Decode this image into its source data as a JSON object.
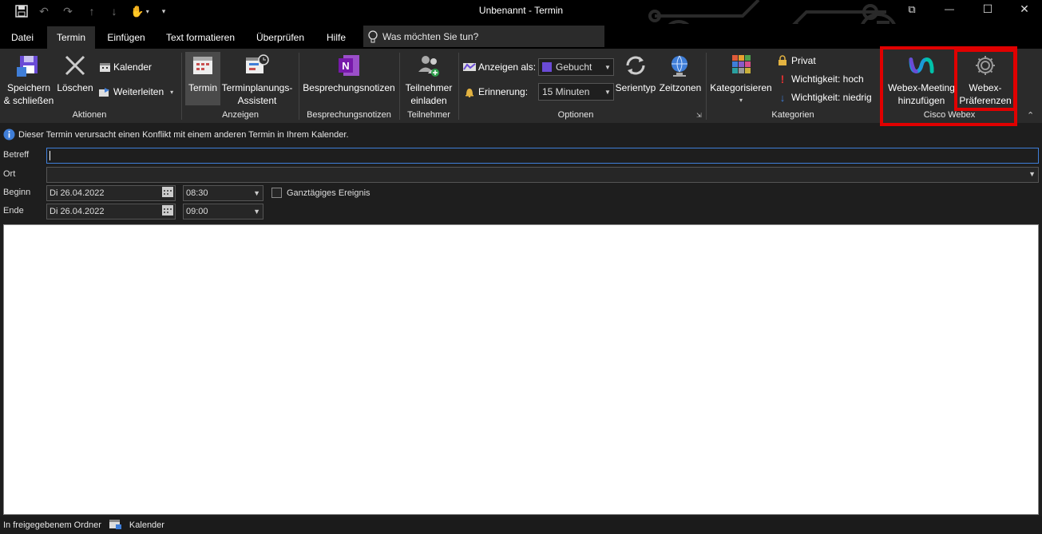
{
  "window": {
    "title": "Unbenannt  -  Termin",
    "controls": {
      "restore": "⧉",
      "minimize": "—",
      "maximize": "☐",
      "close": "✕"
    }
  },
  "tabs": [
    "Datei",
    "Termin",
    "Einfügen",
    "Text formatieren",
    "Überprüfen",
    "Hilfe"
  ],
  "active_tab": "Termin",
  "search_placeholder": "Was möchten Sie tun?",
  "ribbon": {
    "aktionen": {
      "save_label_1": "Speichern",
      "save_label_2": "& schließen",
      "delete_label": "Löschen",
      "calendar_label": "Kalender",
      "forward_label": "Weiterleiten",
      "group_label": "Aktionen"
    },
    "anzeigen": {
      "termin_label": "Termin",
      "assistant_label_1": "Terminplanungs-",
      "assistant_label_2": "Assistent",
      "group_label": "Anzeigen"
    },
    "notizen": {
      "notes_label": "Besprechungsnotizen",
      "group_label": "Besprechungsnotizen"
    },
    "teilnehmer": {
      "invite_label_1": "Teilnehmer",
      "invite_label_2": "einladen",
      "group_label": "Teilnehmer"
    },
    "optionen": {
      "show_as_label": "Anzeigen als:",
      "show_as_value": "Gebucht",
      "reminder_label": "Erinnerung:",
      "reminder_value": "15 Minuten",
      "series_label": "Serientyp",
      "timezones_label": "Zeitzonen",
      "group_label": "Optionen"
    },
    "kategorien": {
      "categorize_label": "Kategorisieren",
      "private_label": "Privat",
      "high_label": "Wichtigkeit: hoch",
      "low_label": "Wichtigkeit: niedrig",
      "group_label": "Kategorien"
    },
    "webex": {
      "add_label_1": "Webex-Meeting",
      "add_label_2": "hinzufügen",
      "prefs_label_1": "Webex-",
      "prefs_label_2": "Präferenzen",
      "group_label": "Cisco Webex"
    }
  },
  "info_bar": "Dieser Termin verursacht einen Konflikt mit einem anderen Termin in Ihrem Kalender.",
  "form": {
    "subject_label": "Betreff",
    "subject_value": "",
    "location_label": "Ort",
    "location_value": "",
    "start_label": "Beginn",
    "start_date": "Di 26.04.2022",
    "start_time": "08:30",
    "allday_label": "Ganztägiges Ereignis",
    "end_label": "Ende",
    "end_date": "Di 26.04.2022",
    "end_time": "09:00"
  },
  "status": {
    "folder_label": "In freigegebenem Ordner",
    "calendar_label": "Kalender"
  },
  "colors": {
    "highlight": "#e00000",
    "accent": "#6a4bd6",
    "onenote": "#7719aa"
  }
}
